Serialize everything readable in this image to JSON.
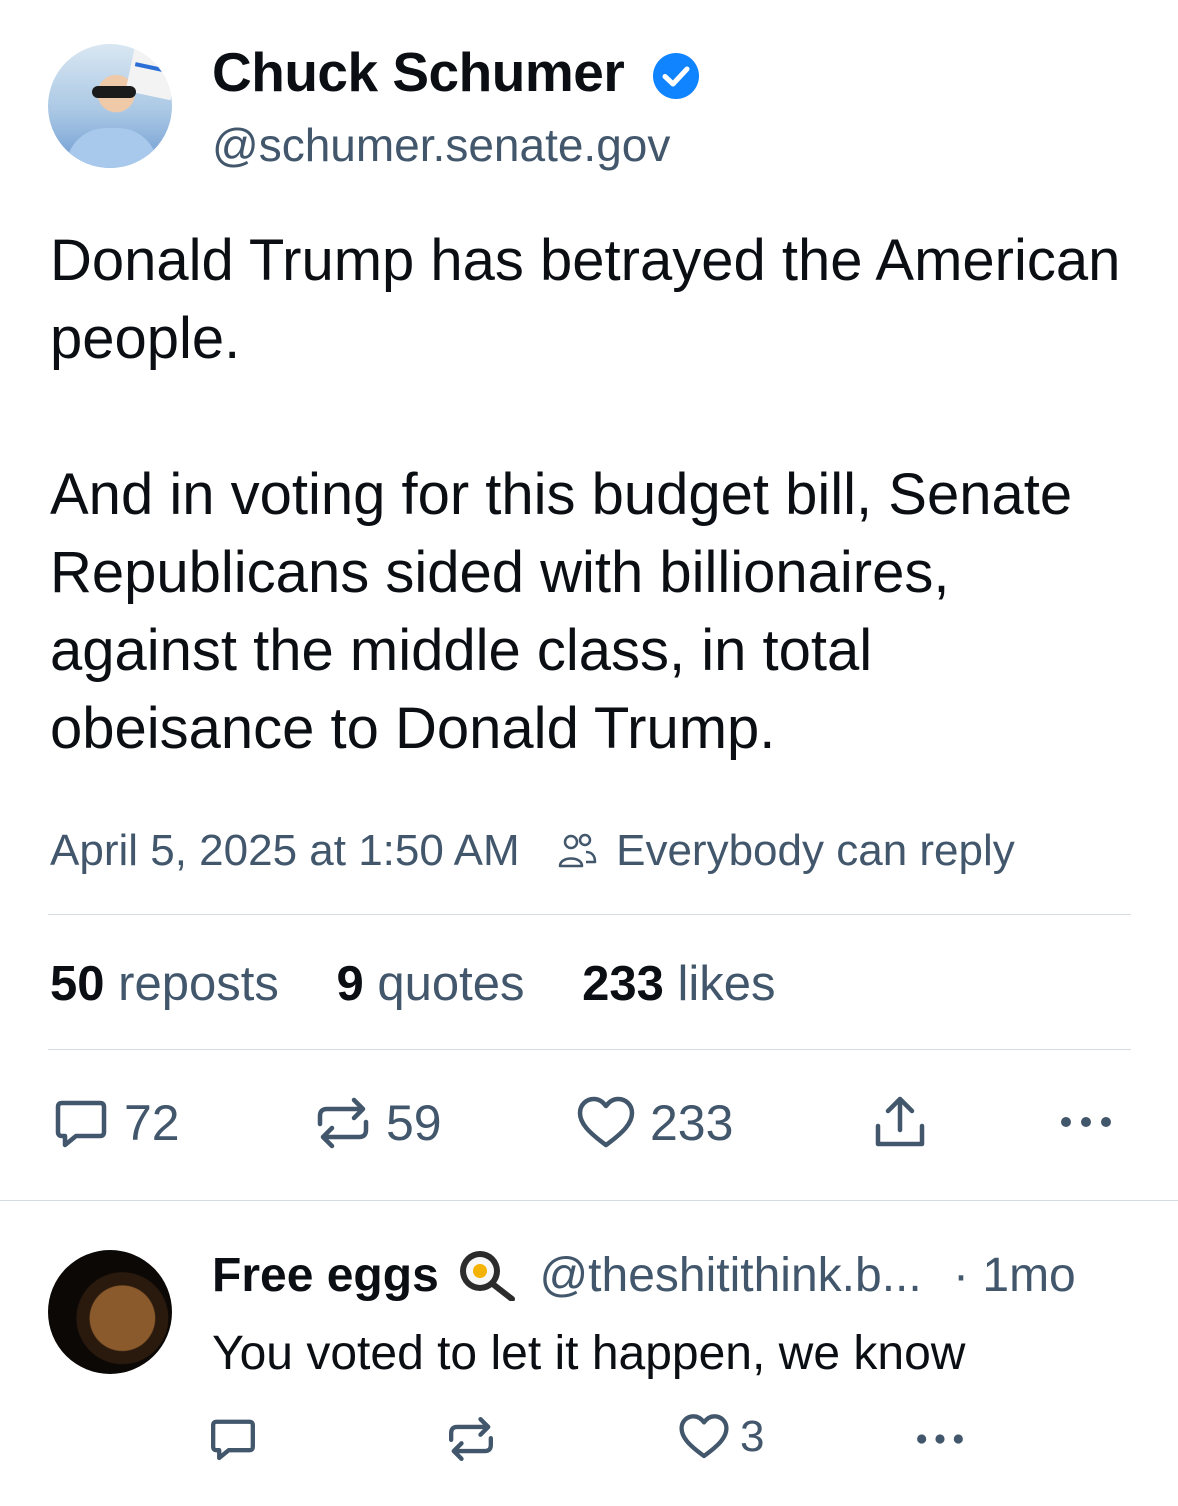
{
  "post": {
    "author_name": "Chuck Schumer",
    "author_handle": "@schumer.senate.gov",
    "text_paragraph_1": "Donald Trump has betrayed the American people.",
    "text_paragraph_2": "And in voting for this budget bill, Senate Republicans sided with billionaires, against the middle class, in total obeisance to Donald Trump.",
    "timestamp": "April 5, 2025 at 1:50 AM",
    "reply_setting": "Everybody can reply",
    "stats": {
      "reposts_count": "50",
      "reposts_label": "reposts",
      "quotes_count": "9",
      "quotes_label": "quotes",
      "likes_count": "233",
      "likes_label": "likes"
    },
    "actions": {
      "reply_count": "72",
      "repost_count": "59",
      "like_count": "233"
    }
  },
  "reply": {
    "author_name": "Free eggs",
    "author_handle": "@theshitithink.b...",
    "time": "· 1mo",
    "text": "You voted to let it happen, we know",
    "like_count": "3"
  },
  "colors": {
    "text": "#0b0f14",
    "muted": "#42576c",
    "verified": "#1083fe",
    "divider": "#d4dbe2"
  }
}
